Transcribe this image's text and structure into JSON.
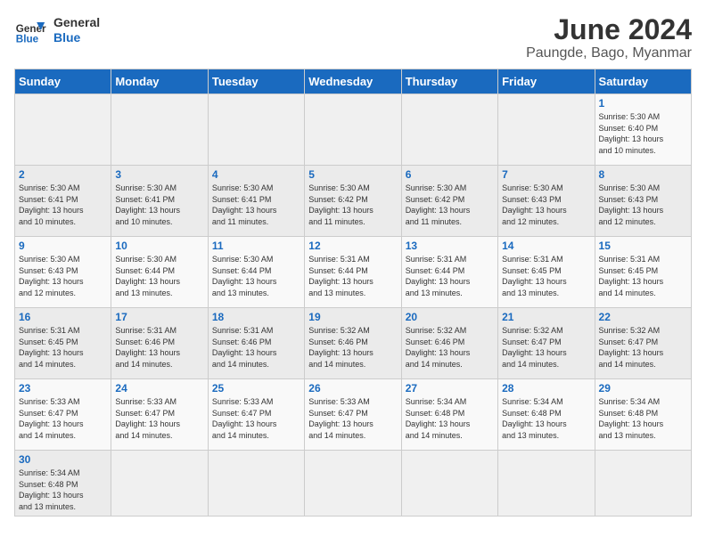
{
  "header": {
    "logo_general": "General",
    "logo_blue": "Blue",
    "month_title": "June 2024",
    "subtitle": "Paungde, Bago, Myanmar"
  },
  "days_of_week": [
    "Sunday",
    "Monday",
    "Tuesday",
    "Wednesday",
    "Thursday",
    "Friday",
    "Saturday"
  ],
  "weeks": [
    [
      {
        "day": "",
        "info": ""
      },
      {
        "day": "",
        "info": ""
      },
      {
        "day": "",
        "info": ""
      },
      {
        "day": "",
        "info": ""
      },
      {
        "day": "",
        "info": ""
      },
      {
        "day": "",
        "info": ""
      },
      {
        "day": "1",
        "info": "Sunrise: 5:30 AM\nSunset: 6:40 PM\nDaylight: 13 hours\nand 10 minutes."
      }
    ],
    [
      {
        "day": "2",
        "info": "Sunrise: 5:30 AM\nSunset: 6:41 PM\nDaylight: 13 hours\nand 10 minutes."
      },
      {
        "day": "3",
        "info": "Sunrise: 5:30 AM\nSunset: 6:41 PM\nDaylight: 13 hours\nand 10 minutes."
      },
      {
        "day": "4",
        "info": "Sunrise: 5:30 AM\nSunset: 6:41 PM\nDaylight: 13 hours\nand 11 minutes."
      },
      {
        "day": "5",
        "info": "Sunrise: 5:30 AM\nSunset: 6:42 PM\nDaylight: 13 hours\nand 11 minutes."
      },
      {
        "day": "6",
        "info": "Sunrise: 5:30 AM\nSunset: 6:42 PM\nDaylight: 13 hours\nand 11 minutes."
      },
      {
        "day": "7",
        "info": "Sunrise: 5:30 AM\nSunset: 6:43 PM\nDaylight: 13 hours\nand 12 minutes."
      },
      {
        "day": "8",
        "info": "Sunrise: 5:30 AM\nSunset: 6:43 PM\nDaylight: 13 hours\nand 12 minutes."
      }
    ],
    [
      {
        "day": "9",
        "info": "Sunrise: 5:30 AM\nSunset: 6:43 PM\nDaylight: 13 hours\nand 12 minutes."
      },
      {
        "day": "10",
        "info": "Sunrise: 5:30 AM\nSunset: 6:44 PM\nDaylight: 13 hours\nand 13 minutes."
      },
      {
        "day": "11",
        "info": "Sunrise: 5:30 AM\nSunset: 6:44 PM\nDaylight: 13 hours\nand 13 minutes."
      },
      {
        "day": "12",
        "info": "Sunrise: 5:31 AM\nSunset: 6:44 PM\nDaylight: 13 hours\nand 13 minutes."
      },
      {
        "day": "13",
        "info": "Sunrise: 5:31 AM\nSunset: 6:44 PM\nDaylight: 13 hours\nand 13 minutes."
      },
      {
        "day": "14",
        "info": "Sunrise: 5:31 AM\nSunset: 6:45 PM\nDaylight: 13 hours\nand 13 minutes."
      },
      {
        "day": "15",
        "info": "Sunrise: 5:31 AM\nSunset: 6:45 PM\nDaylight: 13 hours\nand 14 minutes."
      }
    ],
    [
      {
        "day": "16",
        "info": "Sunrise: 5:31 AM\nSunset: 6:45 PM\nDaylight: 13 hours\nand 14 minutes."
      },
      {
        "day": "17",
        "info": "Sunrise: 5:31 AM\nSunset: 6:46 PM\nDaylight: 13 hours\nand 14 minutes."
      },
      {
        "day": "18",
        "info": "Sunrise: 5:31 AM\nSunset: 6:46 PM\nDaylight: 13 hours\nand 14 minutes."
      },
      {
        "day": "19",
        "info": "Sunrise: 5:32 AM\nSunset: 6:46 PM\nDaylight: 13 hours\nand 14 minutes."
      },
      {
        "day": "20",
        "info": "Sunrise: 5:32 AM\nSunset: 6:46 PM\nDaylight: 13 hours\nand 14 minutes."
      },
      {
        "day": "21",
        "info": "Sunrise: 5:32 AM\nSunset: 6:47 PM\nDaylight: 13 hours\nand 14 minutes."
      },
      {
        "day": "22",
        "info": "Sunrise: 5:32 AM\nSunset: 6:47 PM\nDaylight: 13 hours\nand 14 minutes."
      }
    ],
    [
      {
        "day": "23",
        "info": "Sunrise: 5:33 AM\nSunset: 6:47 PM\nDaylight: 13 hours\nand 14 minutes."
      },
      {
        "day": "24",
        "info": "Sunrise: 5:33 AM\nSunset: 6:47 PM\nDaylight: 13 hours\nand 14 minutes."
      },
      {
        "day": "25",
        "info": "Sunrise: 5:33 AM\nSunset: 6:47 PM\nDaylight: 13 hours\nand 14 minutes."
      },
      {
        "day": "26",
        "info": "Sunrise: 5:33 AM\nSunset: 6:47 PM\nDaylight: 13 hours\nand 14 minutes."
      },
      {
        "day": "27",
        "info": "Sunrise: 5:34 AM\nSunset: 6:48 PM\nDaylight: 13 hours\nand 14 minutes."
      },
      {
        "day": "28",
        "info": "Sunrise: 5:34 AM\nSunset: 6:48 PM\nDaylight: 13 hours\nand 13 minutes."
      },
      {
        "day": "29",
        "info": "Sunrise: 5:34 AM\nSunset: 6:48 PM\nDaylight: 13 hours\nand 13 minutes."
      }
    ],
    [
      {
        "day": "30",
        "info": "Sunrise: 5:34 AM\nSunset: 6:48 PM\nDaylight: 13 hours\nand 13 minutes."
      },
      {
        "day": "",
        "info": ""
      },
      {
        "day": "",
        "info": ""
      },
      {
        "day": "",
        "info": ""
      },
      {
        "day": "",
        "info": ""
      },
      {
        "day": "",
        "info": ""
      },
      {
        "day": "",
        "info": ""
      }
    ]
  ]
}
